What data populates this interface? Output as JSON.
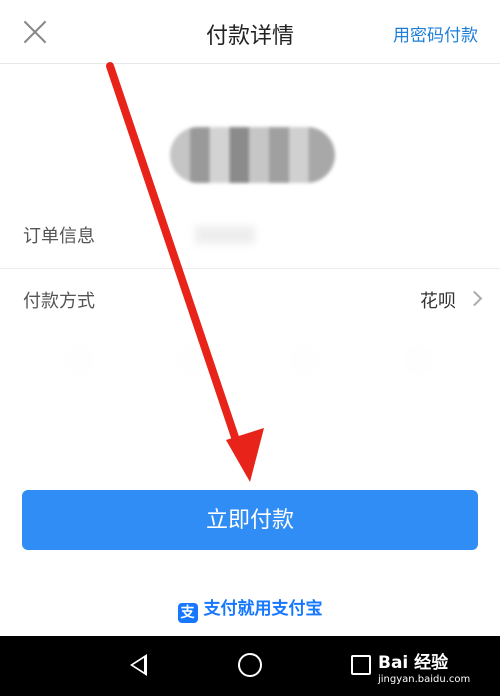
{
  "header": {
    "title": "付款详情",
    "password_pay_label": "用密码付款"
  },
  "order": {
    "label": "订单信息"
  },
  "payment_method": {
    "label": "付款方式",
    "value": "花呗"
  },
  "actions": {
    "pay_now_label": "立即付款"
  },
  "brand": {
    "logo_glyph": "支",
    "slogan": "支付就用支付宝"
  },
  "watermark": {
    "name": "Bai 经验",
    "url": "jingyan.baidu.com"
  },
  "colors": {
    "accent": "#2f8df5",
    "link": "#1e7ed8",
    "annotation": "#e8231a"
  }
}
